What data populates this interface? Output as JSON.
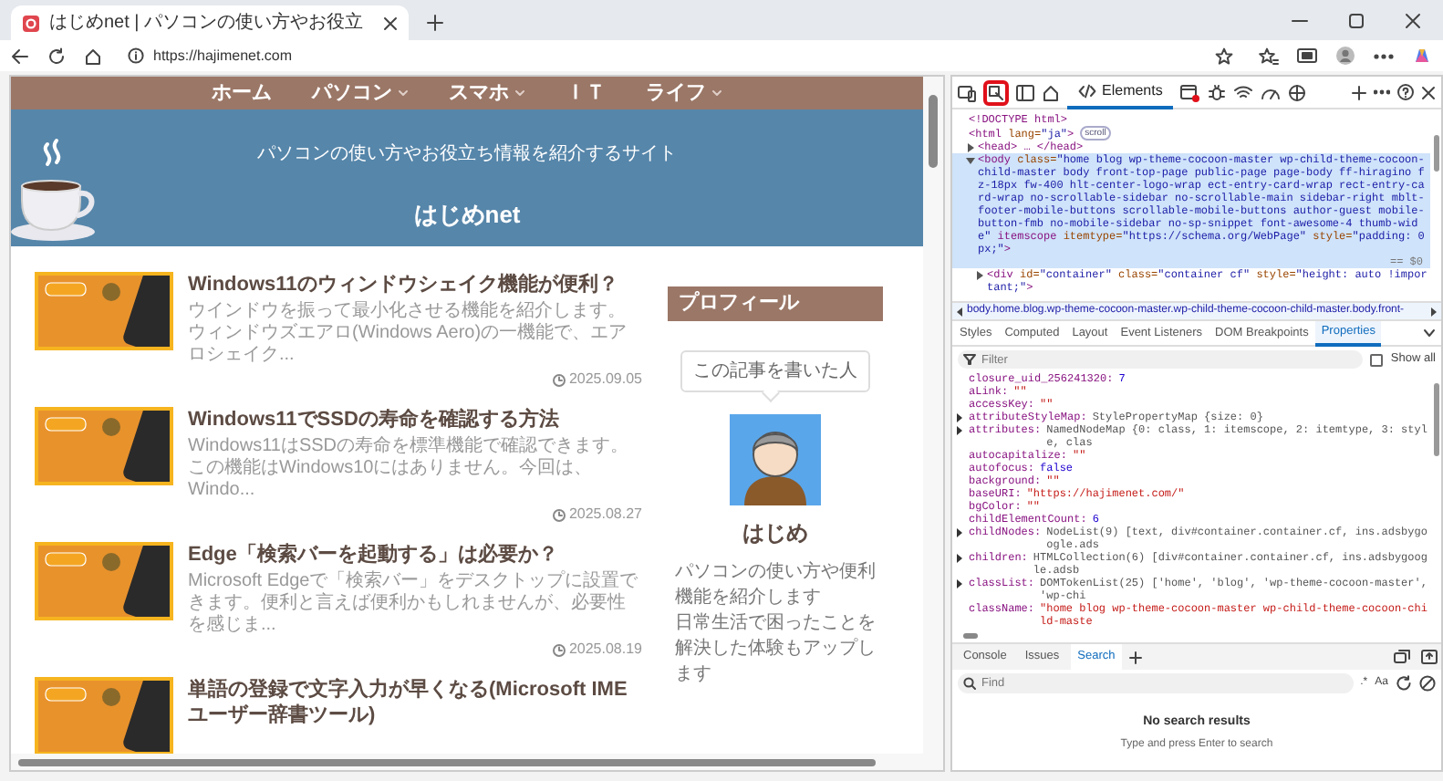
{
  "browser": {
    "tab": {
      "title": "はじめnet | パソコンの使い方やお役立"
    },
    "address": "https://hajimenet.com"
  },
  "site": {
    "nav": [
      {
        "label": "ホーム",
        "has_menu": false
      },
      {
        "label": "パソコン",
        "has_menu": true
      },
      {
        "label": "スマホ",
        "has_menu": true
      },
      {
        "label": "ＩＴ",
        "has_menu": false
      },
      {
        "label": "ライフ",
        "has_menu": true
      }
    ],
    "tagline": "パソコンの使い方やお役立ち情報を紹介するサイト",
    "title": "はじめnet",
    "articles": [
      {
        "title": "Windows11のウィンドウシェイク機能が便利？",
        "excerpt": "ウインドウを振って最小化させる機能を紹介します。ウィンドウズエアロ(Windows Aero)の一機能で、エアロシェイク...",
        "date": "2025.09.05"
      },
      {
        "title": "Windows11でSSDの寿命を確認する方法",
        "excerpt": "Windows11はSSDの寿命を標準機能で確認できます。この機能はWindows10にはありません。今回は、Windo...",
        "date": "2025.08.27"
      },
      {
        "title": "Edge「検索バーを起動する」は必要か？",
        "excerpt": "Microsoft Edgeで「検索バー」をデスクトップに設置できます。便利と言えば便利かもしれませんが、必要性を感じま...",
        "date": "2025.08.19"
      },
      {
        "title": "単語の登録で文字入力が早くなる(Microsoft IME ユーザー辞書ツール)"
      }
    ],
    "sidebar": {
      "heading": "プロフィール",
      "bubble": "この記事を書いた人",
      "name": "はじめ",
      "bio": [
        "パソコンの使い方や便利機能を紹介します",
        "日常生活で困ったことを解決した体験もアップします"
      ]
    }
  },
  "devtools": {
    "tabs": [
      {
        "label": "Elements",
        "selected": true
      }
    ],
    "dom": [
      {
        "text": "<!DOCTYPE html>",
        "expandable": false,
        "selected": false
      },
      {
        "text": "<html lang=\"ja\">",
        "badge": "scroll",
        "expandable": false,
        "selected": false,
        "children": [
          {
            "text": "<head> … </head>",
            "expandable": true,
            "expanded": false,
            "selected": false
          },
          {
            "text": "<body class=\"home blog wp-theme-cocoon-master wp-child-theme-cocoon-child-master body front-top-page public-page page-body ff-hiragino fz-18px fw-400 hlt-center-logo-wrap ect-entry-card-wrap rect-entry-card-wrap no-scrollable-sidebar no-scrollable-main sidebar-right mblt-footer-mobile-buttons scrollable-mobile-buttons author-guest mobile-button-fmb no-mobile-sidebar no-sp-snippet font-awesome-4 thumb-wide\" itemscope itemtype=\"https://schema.org/WebPage\" style=\"padding: 0px;\">",
            "suffix": "== $0",
            "expandable": true,
            "expanded": true,
            "selected": true,
            "children": [
              {
                "text": "<div id=\"container\" class=\"container cf\" style=\"height: auto !important;\">",
                "expandable": true,
                "expanded": false,
                "selected": false
              }
            ]
          }
        ]
      }
    ],
    "breadcrumb": "body.home.blog.wp-theme-cocoon-master.wp-child-theme-cocoon-child-master.body.front-",
    "panel_tabs": [
      {
        "label": "Styles",
        "selected": false
      },
      {
        "label": "Computed",
        "selected": false
      },
      {
        "label": "Layout",
        "selected": false
      },
      {
        "label": "Event Listeners",
        "selected": false
      },
      {
        "label": "DOM Breakpoints",
        "selected": false
      },
      {
        "label": "Properties",
        "selected": true
      }
    ],
    "filter": {
      "placeholder": "Filter"
    },
    "show_all": {
      "label": "Show all",
      "checked": false
    },
    "properties": [
      {
        "key": "closure_uid_256241320:",
        "value": "7",
        "kind": "number",
        "expandable": false
      },
      {
        "key": "aLink:",
        "value": "\"\"",
        "kind": "string",
        "expandable": false
      },
      {
        "key": "accessKey:",
        "value": "\"\"",
        "kind": "string",
        "expandable": false
      },
      {
        "key": "attributeStyleMap:",
        "value": "StylePropertyMap {size: 0}",
        "kind": "object",
        "expandable": true
      },
      {
        "key": "attributes:",
        "value": "NamedNodeMap {0: class, 1: itemscope, 2: itemtype, 3: style, clas",
        "kind": "object",
        "expandable": true
      },
      {
        "key": "autocapitalize:",
        "value": "\"\"",
        "kind": "string",
        "expandable": false
      },
      {
        "key": "autofocus:",
        "value": "false",
        "kind": "boolean",
        "expandable": false
      },
      {
        "key": "background:",
        "value": "\"\"",
        "kind": "string",
        "expandable": false
      },
      {
        "key": "baseURI:",
        "value": "\"https://hajimenet.com/\"",
        "kind": "string",
        "expandable": false
      },
      {
        "key": "bgColor:",
        "value": "\"\"",
        "kind": "string",
        "expandable": false
      },
      {
        "key": "childElementCount:",
        "value": "6",
        "kind": "number",
        "expandable": false
      },
      {
        "key": "childNodes:",
        "value": "NodeList(9) [text, div#container.container.cf, ins.adsbygoogle.ads",
        "kind": "object",
        "expandable": true
      },
      {
        "key": "children:",
        "value": "HTMLCollection(6) [div#container.container.cf, ins.adsbygoogle.adsb",
        "kind": "object",
        "expandable": true
      },
      {
        "key": "classList:",
        "value": "DOMTokenList(25) ['home', 'blog', 'wp-theme-cocoon-master', 'wp-chi",
        "kind": "object",
        "expandable": true
      },
      {
        "key": "className:",
        "value": "\"home blog wp-theme-cocoon-master wp-child-theme-cocoon-child-maste",
        "kind": "string",
        "expandable": false
      }
    ],
    "drawer_tabs": [
      {
        "label": "Console",
        "selected": false
      },
      {
        "label": "Issues",
        "selected": false
      },
      {
        "label": "Search",
        "selected": true
      }
    ],
    "search": {
      "placeholder": "Find",
      "regex": ".*",
      "case": "Aa"
    },
    "empty": {
      "title": "No search results",
      "hint": "Type and press Enter to search"
    }
  }
}
